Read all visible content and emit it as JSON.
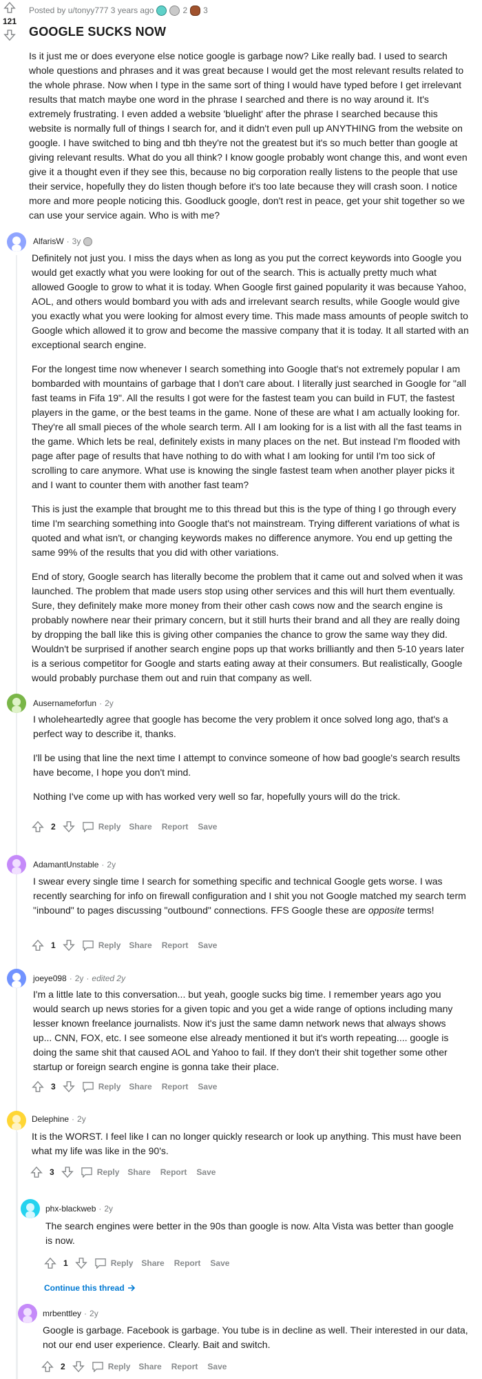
{
  "post": {
    "meta": "Posted by u/tonyy777 3 years ago",
    "award_count_1": "2",
    "award_count_2": "3",
    "score": "121",
    "title": "GOOGLE SUCKS NOW",
    "body": "Is it just me or does everyone else notice google is garbage now? Like really bad. I used to search whole questions and phrases and it was great because I would get the most relevant results related to the whole phrase. Now when I type in the same sort of thing I would have typed before I get irrelevant results that match maybe one word in the phrase I searched and there is no way around it. It's extremely frustrating. I even added a website 'bluelight' after the phrase I searched because this website is normally full of things I search for, and it didn't even pull up ANYTHING from the website on google. I have switched to bing and tbh they're not the greatest but it's so much better than google at giving relevant results. What do you all think? I know google probably wont change this, and wont even give it a thought even if they see this, because no big corporation really listens to the people that use their service, hopefully they do listen though before it's too late because they will crash soon. I notice more and more people noticing this. Goodluck google, don't rest in peace, get your shit together so we can use your service again. Who is with me?"
  },
  "actions": {
    "reply": "Reply",
    "share": "Share",
    "report": "Report",
    "save": "Save"
  },
  "comments": [
    {
      "author": "AlfarisW",
      "age": "3y",
      "paragraphs": [
        "Definitely not just you. I miss the days when as long as you put the correct keywords into Google you would get exactly what you were looking for out of the search. This is actually pretty much what allowed Google to grow to what it is today. When Google first gained popularity it was because Yahoo, AOL, and others would bombard you with ads and irrelevant search results, while Google would give you exactly what you were looking for almost every time. This made mass amounts of people switch to Google which allowed it to grow and become the massive company that it is today. It all started with an exceptional search engine.",
        "For the longest time now whenever I search something into Google that's not extremely popular I am bombarded with mountains of garbage that I don't care about. I literally just searched in Google for \"all fast teams in Fifa 19\". All the results I got were for the fastest team you can build in FUT, the fastest players in the game, or the best teams in the game. None of these are what I am actually looking for. They're all small pieces of the whole search term. All I am looking for is a list with all the fast teams in the game. Which lets be real, definitely exists in many places on the net. But instead I'm flooded with page after page of results that have nothing to do with what I am looking for until I'm too sick of scrolling to care anymore. What use is knowing the single fastest team when another player picks it and I want to counter them with another fast team?",
        "This is just the example that brought me to this thread but this is the type of thing I go through every time I'm searching something into Google that's not mainstream. Trying different variations of what is quoted and what isn't, or changing keywords makes no difference anymore. You end up getting the same 99% of the results that you did with other variations.",
        "End of story, Google search has literally become the problem that it came out and solved when it was launched. The problem that made users stop using other services and this will hurt them eventually. Sure, they definitely make more money from their other cash cows now and the search engine is probably nowhere near their primary concern, but it still hurts their brand and all they are really doing by dropping the ball like this is giving other companies the chance to grow the same way they did. Wouldn't be surprised if another search engine pops up that works brilliantly and then 5-10 years later is a serious competitor for Google and starts eating away at their consumers. But realistically, Google would probably purchase them out and ruin that company as well."
      ]
    },
    {
      "author": "Ausernameforfun",
      "age": "2y",
      "score": "2",
      "paragraphs": [
        "I wholeheartedly agree that google has become the very problem it once solved long ago, that's a perfect way to describe it, thanks.",
        "I'll be using that line the next time I attempt to convince someone of how bad google's search results have become, I hope you don't mind.",
        "Nothing I've come up with has worked very well so far, hopefully yours will do the trick."
      ]
    },
    {
      "author": "AdamantUnstable",
      "age": "2y",
      "score": "1",
      "text_before": "I swear every single time I search for something specific and technical Google gets worse. I was recently searching for info on firewall configuration and I shit you not Google matched my search term \"inbound\" to pages discussing \"outbound\" connections. FFS Google these are ",
      "text_em": "opposite",
      "text_after": " terms!"
    },
    {
      "author": "joeye098",
      "age": "2y",
      "edited": "edited 2y",
      "score": "3",
      "paragraphs": [
        "I'm a little late to this conversation... but yeah, google sucks big time. I remember years ago you would search up news stories for a given topic and you get a wide range of options including many lesser known freelance journalists. Now it's just the same damn network news that always shows up... CNN, FOX, etc. I see someone else already mentioned it but it's worth repeating.... google is doing the same shit that caused AOL and Yahoo to fail. If they don't their shit together some other startup or foreign search engine is gonna take their place."
      ]
    },
    {
      "author": "Delephine",
      "age": "2y",
      "score": "3",
      "paragraphs": [
        "It is the WORST. I feel like I can no longer quickly research or look up anything. This must have been what my life was like in the 90's."
      ]
    },
    {
      "author": "phx-blackweb",
      "age": "2y",
      "score": "1",
      "paragraphs": [
        "The search engines were better in the 90s than google is now. Alta Vista was better than google is now."
      ],
      "continue": "Continue this thread"
    },
    {
      "author": "mrbenttley",
      "age": "2y",
      "score": "2",
      "paragraphs": [
        "Google is garbage. Facebook is garbage. You tube is in decline as well. Their interested in our data, not our end user experience. Clearly. Bait and switch."
      ]
    }
  ],
  "colors": {
    "avatar_alfaris": "#8fa4ff",
    "avatar_ausername": "#7ab648",
    "avatar_adamant": "#c58af9",
    "avatar_joeye": "#7193ff",
    "avatar_delephine": "#ffd635",
    "avatar_phx": "#24d3ef",
    "avatar_mrbenttley": "#c58af9",
    "link": "#0079d3"
  }
}
